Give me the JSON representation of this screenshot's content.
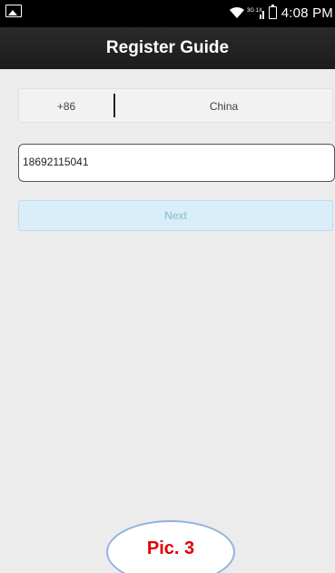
{
  "status_bar": {
    "time": "4:08 PM",
    "signal_text": "3G 1X",
    "icons": [
      "gallery-notification-icon",
      "wifi-icon",
      "signal-icon",
      "battery-icon"
    ]
  },
  "header": {
    "title": "Register Guide"
  },
  "country_selector": {
    "code": "+86",
    "country": "China"
  },
  "phone_input": {
    "value": "18692115041"
  },
  "next_button": {
    "label": "Next"
  },
  "caption": {
    "text": "Pic. 3",
    "color": "#e00000",
    "border_color": "#8fb4dc"
  },
  "colors": {
    "title_bar": "#1c1c1c",
    "background": "#ececec",
    "next_button_bg": "#d9eef9",
    "next_button_text": "#8ab6d0"
  }
}
